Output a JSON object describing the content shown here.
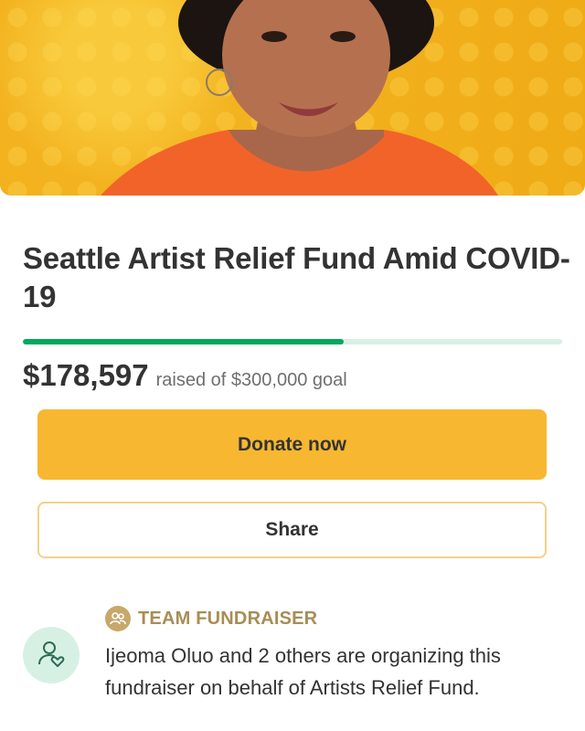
{
  "campaign": {
    "title": "Seattle Artist Relief Fund Amid COVID-19",
    "raised_amount": "$178,597",
    "goal_text": "raised of $300,000 goal",
    "progress_fraction": 0.595
  },
  "actions": {
    "donate_label": "Donate now",
    "share_label": "Share"
  },
  "organizer": {
    "badge_label": "TEAM FUNDRAISER",
    "description": "Ijeoma Oluo and 2 others are organizing this fundraiser on behalf of Artists Relief Fund."
  },
  "colors": {
    "brand_green": "#02a95c",
    "donate_yellow": "#f7b731",
    "badge_gold": "#a88d55"
  },
  "icons": {
    "team": "people-icon",
    "organizer": "person-heart-icon"
  }
}
